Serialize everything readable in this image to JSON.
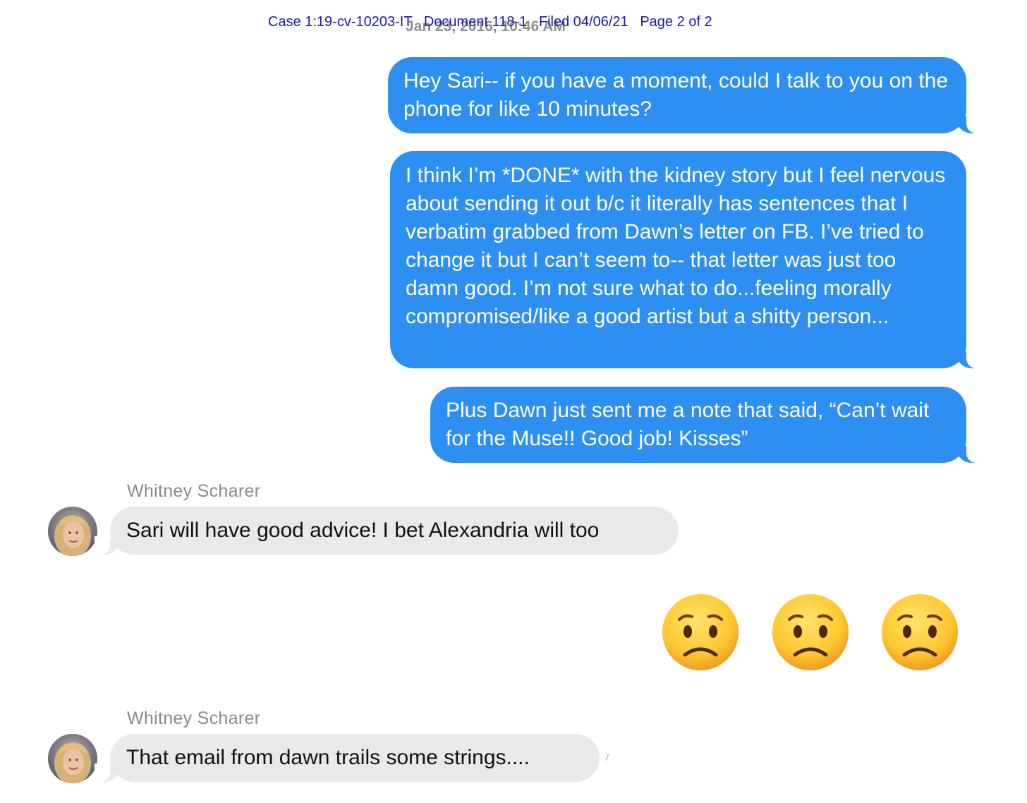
{
  "header": {
    "court_stamp": "Case 1:19-cv-10203-IT   Document 118-1   Filed 04/06/21   Page 2 of 2",
    "timestamp": "Jan 23, 2016, 10:46 AM"
  },
  "messages": [
    {
      "direction": "sent",
      "text": "Hey Sari-- if you have a moment, could I talk to you on the phone for like 10 minutes?"
    },
    {
      "direction": "sent",
      "text": "I think I’m *DONE* with the kidney story but I feel nervous about sending it out b/c it literally has sentences that I verbatim grabbed from Dawn’s letter on FB. I’ve tried to change it but I can’t seem to-- that letter was just too damn good. I’m not sure what to do...feeling morally compromised/like a good artist but a shitty person..."
    },
    {
      "direction": "sent",
      "text": "Plus Dawn just sent me a note that said, “Can’t wait for the Muse!! Good job! Kisses”"
    },
    {
      "direction": "received",
      "sender": "Whitney Scharer",
      "text": "Sari will have good advice! I bet Alexandria will too"
    },
    {
      "direction": "sent",
      "emoji": [
        "worried-face",
        "worried-face",
        "worried-face"
      ]
    },
    {
      "direction": "received",
      "sender": "Whitney Scharer",
      "text": "That email from dawn trails some strings...."
    }
  ],
  "colors": {
    "sent_bubble": "#2e8ff2",
    "received_bubble": "#e9e9eb",
    "court_stamp": "#1a1aa8",
    "timestamp": "#8e8e93",
    "sender_name": "#8a8a8e"
  }
}
